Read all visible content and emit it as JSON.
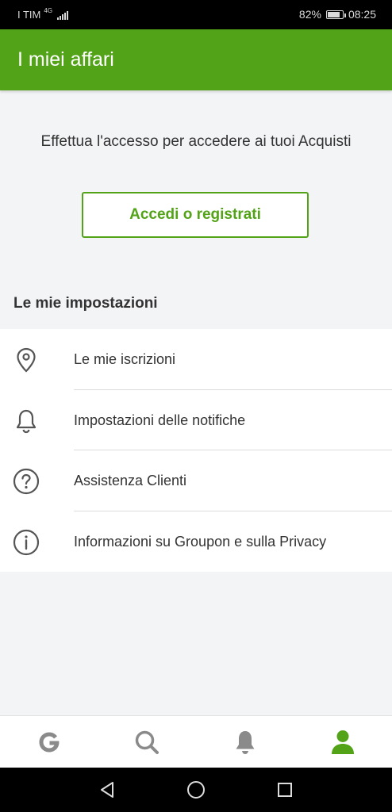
{
  "status_bar": {
    "carrier": "I TIM",
    "network": "4G",
    "battery": "82%",
    "time": "08:25"
  },
  "app_bar": {
    "title": "I miei affari"
  },
  "login": {
    "prompt": "Effettua l'accesso per accedere ai tuoi Acquisti",
    "button_label": "Accedi o registrati"
  },
  "settings": {
    "heading": "Le mie impostazioni",
    "items": [
      {
        "label": "Le mie iscrizioni",
        "icon": "location-pin-icon"
      },
      {
        "label": "Impostazioni delle notifiche",
        "icon": "bell-icon"
      },
      {
        "label": "Assistenza Clienti",
        "icon": "question-circle-icon"
      },
      {
        "label": "Informazioni su Groupon e sulla Privacy",
        "icon": "info-circle-icon"
      }
    ]
  },
  "bottom_nav": {
    "tabs": [
      {
        "name": "home",
        "icon": "groupon-g-icon"
      },
      {
        "name": "search",
        "icon": "search-icon"
      },
      {
        "name": "notifications",
        "icon": "bell-icon"
      },
      {
        "name": "profile",
        "icon": "person-icon",
        "active": true
      }
    ]
  },
  "colors": {
    "brand_green": "#53a318",
    "inactive_icon": "#8a8a8a",
    "background": "#f3f4f6"
  }
}
